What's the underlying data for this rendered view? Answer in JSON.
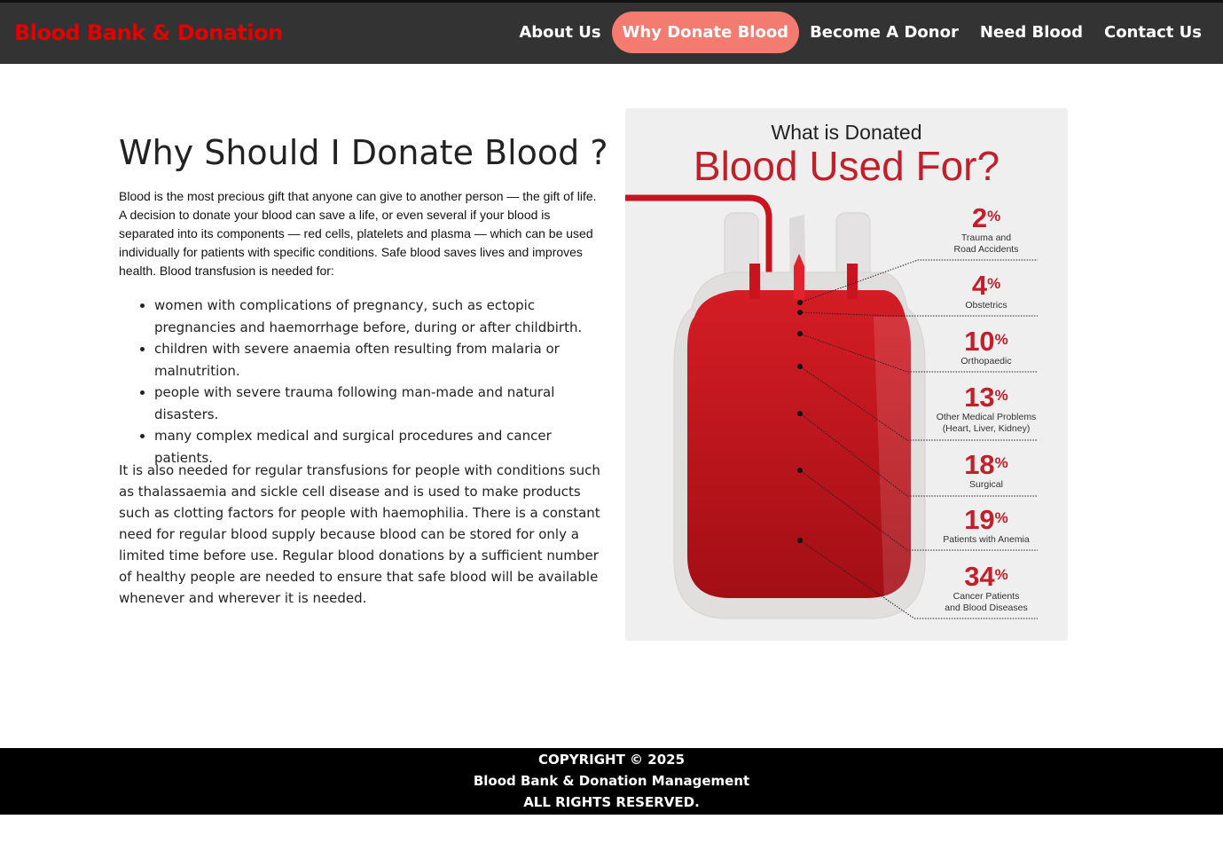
{
  "brand": "Blood Bank & Donation",
  "nav": {
    "items": [
      "About Us",
      "Why Donate Blood",
      "Become A Donor",
      "Need Blood",
      "Contact Us"
    ],
    "active": "Why Donate Blood",
    "active_color": "#f47b6f"
  },
  "main": {
    "title": "Why Should I Donate Blood ?",
    "intro": "Blood is the most precious gift that anyone can give to another person — the gift of life. A decision to donate your blood can save a life, or even several if your blood is separated into its components — red cells, platelets and plasma — which can be used individually for patients with specific conditions. Safe blood saves lives and improves health. Blood transfusion is needed for:",
    "needs": [
      "women with complications of pregnancy, such as ectopic pregnancies and haemorrhage before, during or after childbirth.",
      "children with severe anaemia often resulting from malaria or malnutrition.",
      "people with severe trauma following man-made and natural disasters.",
      "many complex medical and surgical procedures and cancer patients."
    ],
    "outro": "It is also needed for regular transfusions for people with conditions such as thalassaemia and sickle cell disease and is used to make products such as clotting factors for people with haemophilia. There is a constant need for regular blood supply because blood can be stored for only a limited time before use. Regular blood donations by a sufficient number of healthy people are needed to ensure that safe blood will be available whenever and wherever it is needed."
  },
  "infographic": {
    "subtitle": "What is Donated",
    "title": "Blood Used For?",
    "accent": "#c0202a",
    "pct_sign": "%",
    "stats": [
      {
        "value": "2",
        "label1": "Trauma and",
        "label2": "Road Accidents"
      },
      {
        "value": "4",
        "label1": "Obstetrics",
        "label2": ""
      },
      {
        "value": "10",
        "label1": "Orthopaedic",
        "label2": ""
      },
      {
        "value": "13",
        "label1": "Other Medical Problems",
        "label2": "(Heart, Liver, Kidney)"
      },
      {
        "value": "18",
        "label1": "Surgical",
        "label2": ""
      },
      {
        "value": "19",
        "label1": "Patients with Anemia",
        "label2": ""
      },
      {
        "value": "34",
        "label1": "Cancer Patients",
        "label2": "and Blood Diseases"
      }
    ]
  },
  "footer": {
    "line1": "COPYRIGHT © 2025",
    "line2": "Blood Bank & Donation Management",
    "line3": "ALL RIGHTS RESERVED."
  }
}
